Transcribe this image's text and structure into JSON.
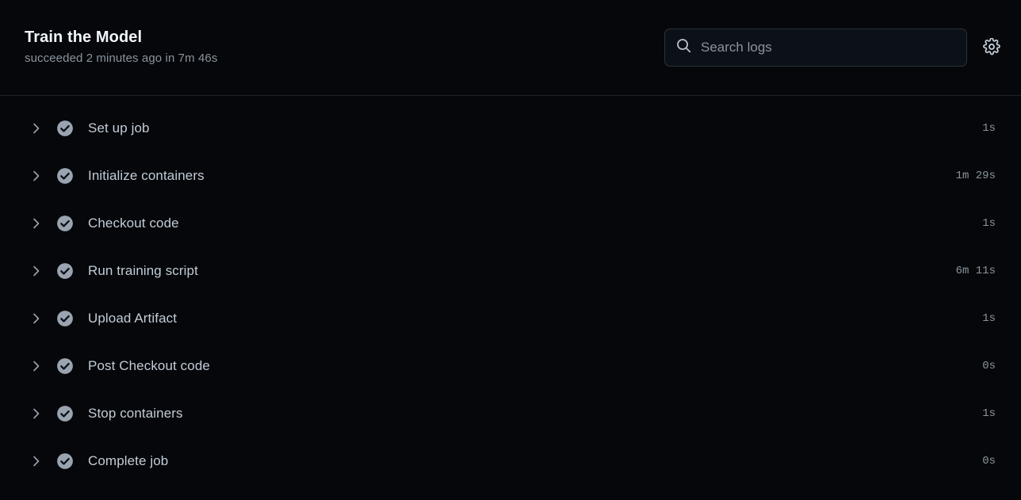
{
  "header": {
    "title": "Train the Model",
    "subtitle": "succeeded 2 minutes ago in 7m 46s",
    "search": {
      "placeholder": "Search logs",
      "value": "",
      "icon": "search-icon"
    },
    "settings_button": {
      "icon": "gear-icon",
      "label": "Settings"
    }
  },
  "steps": [
    {
      "label": "Set up job",
      "duration": "1s",
      "status": "succeeded",
      "expand_icon": "chevron-right-icon",
      "status_icon": "check-circle-icon"
    },
    {
      "label": "Initialize containers",
      "duration": "1m 29s",
      "status": "succeeded",
      "expand_icon": "chevron-right-icon",
      "status_icon": "check-circle-icon"
    },
    {
      "label": "Checkout code",
      "duration": "1s",
      "status": "succeeded",
      "expand_icon": "chevron-right-icon",
      "status_icon": "check-circle-icon"
    },
    {
      "label": "Run training script",
      "duration": "6m 11s",
      "status": "succeeded",
      "expand_icon": "chevron-right-icon",
      "status_icon": "check-circle-icon"
    },
    {
      "label": "Upload Artifact",
      "duration": "1s",
      "status": "succeeded",
      "expand_icon": "chevron-right-icon",
      "status_icon": "check-circle-icon"
    },
    {
      "label": "Post Checkout code",
      "duration": "0s",
      "status": "succeeded",
      "expand_icon": "chevron-right-icon",
      "status_icon": "check-circle-icon"
    },
    {
      "label": "Stop containers",
      "duration": "1s",
      "status": "succeeded",
      "expand_icon": "chevron-right-icon",
      "status_icon": "check-circle-icon"
    },
    {
      "label": "Complete job",
      "duration": "0s",
      "status": "succeeded",
      "expand_icon": "chevron-right-icon",
      "status_icon": "check-circle-icon"
    }
  ],
  "colors": {
    "background": "#05070a",
    "text_primary": "#f0f6fc",
    "text_secondary": "#8b949e",
    "text_body": "#c3ccd7",
    "border": "#1d222a",
    "status_success": "#9aa4b0",
    "input_background": "#0c1017",
    "input_border": "#2b313a"
  }
}
